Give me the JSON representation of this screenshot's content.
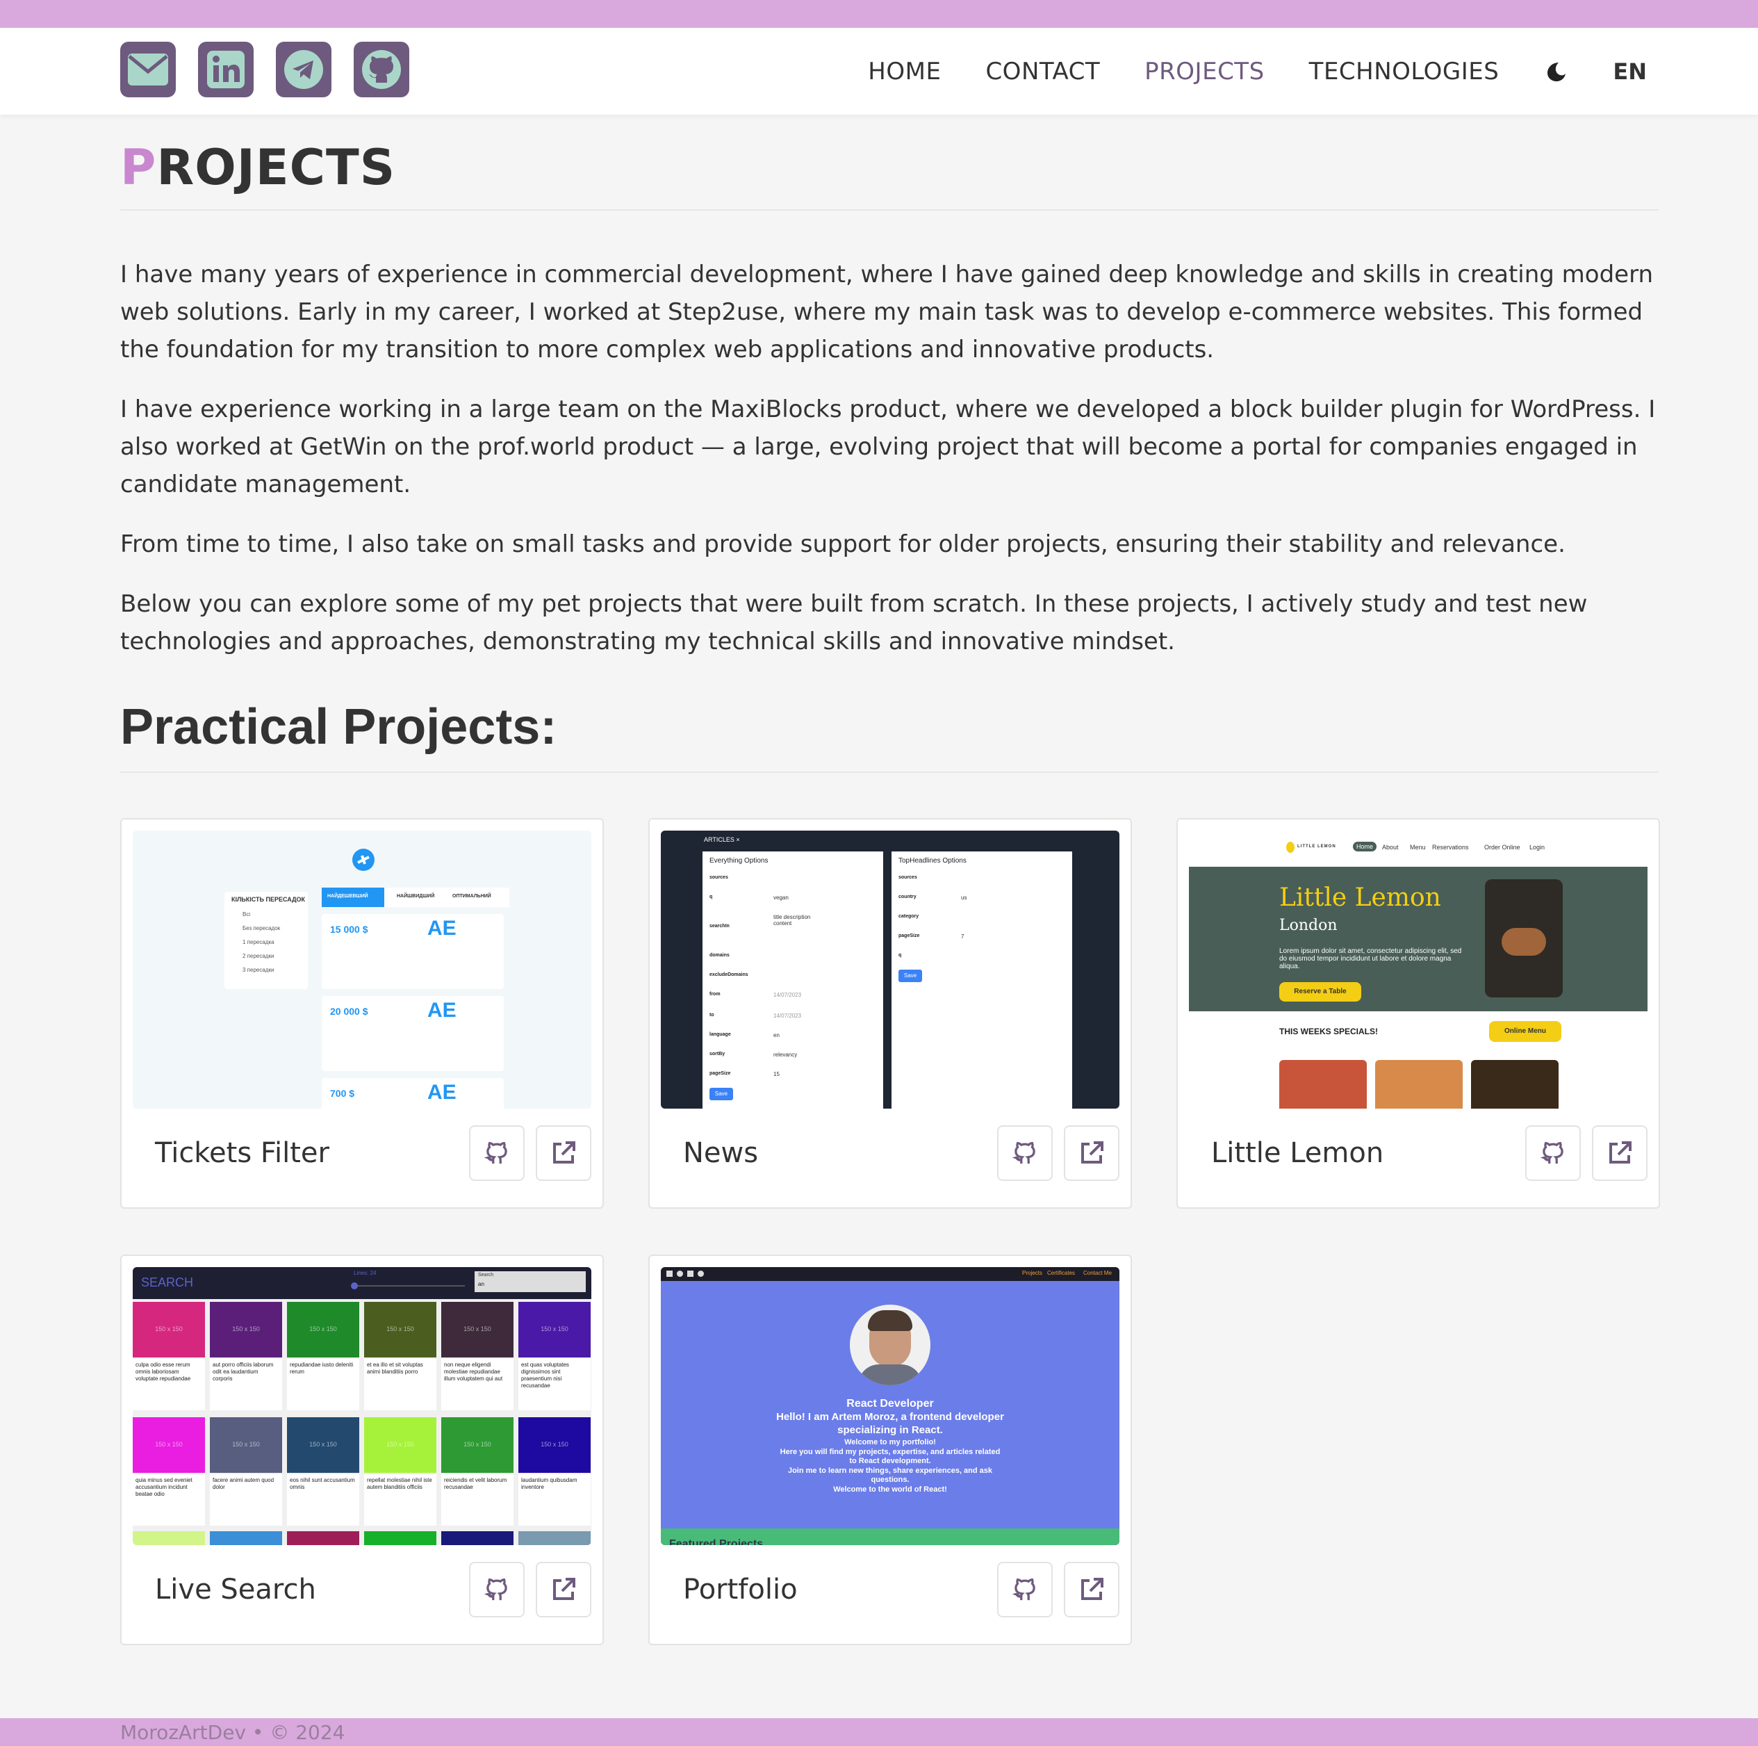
{
  "header": {
    "social": [
      {
        "name": "email",
        "icon": "envelope-icon"
      },
      {
        "name": "linkedin",
        "icon": "linkedin-icon"
      },
      {
        "name": "telegram",
        "icon": "telegram-icon"
      },
      {
        "name": "github",
        "icon": "github-icon"
      }
    ],
    "nav": {
      "home": "HOME",
      "contact": "CONTACT",
      "projects": "PROJECTS",
      "technologies": "TECHNOLOGIES",
      "active": "projects"
    },
    "theme_icon": "moon-icon",
    "language": "EN"
  },
  "colors": {
    "accent_bar": "#d9a9dd",
    "icon_bg": "#6e5a7e",
    "title_first_letter": "#c987cf"
  },
  "page": {
    "title_first": "P",
    "title_rest": "ROJECTS",
    "paragraphs": [
      "I have many years of experience in commercial development, where I have gained deep knowledge and skills in creating modern web solutions. Early in my career, I worked at Step2use, where my main task was to develop e-commerce websites. This formed the foundation for my transition to more complex web applications and innovative products.",
      "I have experience working in a large team on the MaxiBlocks product, where we developed a block builder plugin for WordPress. I also worked at GetWin on the prof.world product — a large, evolving project that will become a portal for companies engaged in candidate management.",
      "From time to time, I also take on small tasks and provide support for older projects, ensuring their stability and relevance.",
      "Below you can explore some of my pet projects that were built from scratch. In these projects, I actively study and test new technologies and approaches, demonstrating my technical skills and innovative mindset."
    ],
    "section_title": "Practical Projects:"
  },
  "projects": [
    {
      "title": "Tickets Filter",
      "thumb": {
        "filter_title": "КІЛЬКІСТЬ ПЕРЕСАДОК",
        "filter_options": [
          "Всі",
          "Без пересадок",
          "1 пересадка",
          "2 пересадки",
          "3 пересадки"
        ],
        "tabs": [
          "НАЙДЕШЕВШИЙ",
          "НАЙШВИДШИЙ",
          "ОПТИМАЛЬНИЙ"
        ],
        "prices": [
          "15 000 $",
          "20 000 $",
          "700 $"
        ]
      }
    },
    {
      "title": "News",
      "thumb": {
        "tab": "ARTICLES ×",
        "left_title": "Everything Options",
        "left_fields": [
          "sources",
          "q",
          "searchIn",
          "domains",
          "excludeDomains",
          "from",
          "to",
          "language",
          "sortBy",
          "pageSize"
        ],
        "left_values": [
          "",
          "vegan",
          "title description content",
          "",
          "",
          "14/07/2023",
          "14/07/2023",
          "en",
          "relevancy",
          "15"
        ],
        "right_title": "TopHeadlines Options",
        "right_fields": [
          "sources",
          "country",
          "category",
          "pageSize",
          "q"
        ],
        "right_values": [
          "",
          "us",
          "",
          "7",
          ""
        ],
        "save": "Save"
      }
    },
    {
      "title": "Little Lemon",
      "thumb": {
        "logo": "LITTLE LEMON",
        "nav": [
          "Home",
          "About",
          "Menu",
          "Reservations",
          "Order Online",
          "Login"
        ],
        "hero_title": "Little Lemon",
        "hero_city": "London",
        "hero_text": "Lorem ipsum dolor sit amet, consectetur adipiscing elit, sed do eiusmod tempor incididunt ut labore et dolore magna aliqua.",
        "hero_button": "Reserve a Table",
        "specials": "THIS WEEKS SPECIALS!",
        "menu_button": "Online Menu"
      }
    },
    {
      "title": "Live Search",
      "thumb": {
        "heading": "SEARCH",
        "lines_label": "Lines: 24",
        "search_label": "Search",
        "search_value": "an",
        "tile_label": "150 x 150",
        "row1_colors": [
          "#d6277f",
          "#5b1f7a",
          "#1e8a2a",
          "#4b5e1f",
          "#3e2a3a",
          "#4a19a8"
        ],
        "row1_texts": [
          "culpa odio esse rerum omnis laboriosam voluptate repudiandae",
          "aut porro officiis laborum odit ea laudantium corporis",
          "repudiandae iusto deleniti rerum",
          "et ea illo et sit voluptas animi blanditiis porro",
          "non neque eligendi molestiae repudiandae illum voluptatem qui aut",
          "est quas voluptates dignissimos sint praesentium nisi recusandae"
        ],
        "row2_colors": [
          "#e91ee0",
          "#575e80",
          "#234a6e",
          "#a6f23a",
          "#2e9a34",
          "#1e0aa0"
        ],
        "row2_texts": [
          "quia minus sed eveniet accusantium incidunt beatae odio",
          "facere animi autem quod dolor",
          "eos nihil sunt accusantium omnis",
          "repellat molestiae nihil iste autem blanditiis officiis",
          "reiciendis et velit laborum recusandae",
          "laudantium quibusdam inventore"
        ],
        "row3_colors": [
          "#d2f58a",
          "#3a8fd6",
          "#9e1f57",
          "#17b02a",
          "#1a1a7a",
          "#7a9ab0"
        ]
      }
    },
    {
      "title": "Portfolio",
      "thumb": {
        "topnav": [
          "Projects",
          "Certificates",
          "Contact Me"
        ],
        "role": "React Developer",
        "greeting": "Hello! I am Artem Moroz, a frontend developer specializing in React.",
        "welcome": "Welcome to my portfolio!",
        "text": "Here you will find my projects, expertise, and articles related to React development.",
        "join": "Join me to learn new things, share experiences, and ask questions.",
        "bottom": "Welcome to the world of React!",
        "section": "Featured Projects"
      }
    }
  ],
  "buttons": {
    "github_icon": "github-icon",
    "external_icon": "external-link-icon"
  },
  "footer": {
    "text": "MorozArtDev • © 2024"
  }
}
